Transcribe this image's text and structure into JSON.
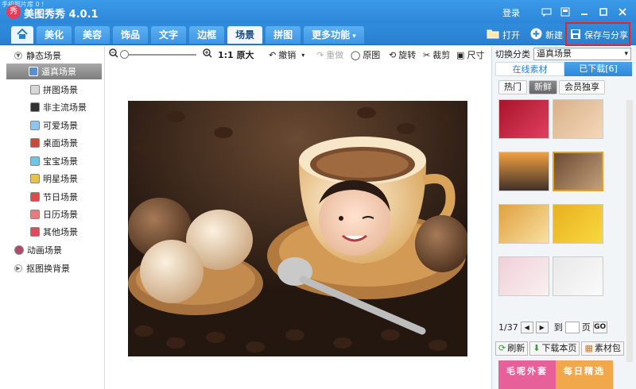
{
  "titlebar": {
    "tiny_text": "手机照片库 0 !",
    "app_title": "美图秀秀 4.0.1",
    "login": "登录",
    "window_icons": [
      "feedback-icon",
      "skin-icon",
      "minimize-icon",
      "maximize-icon",
      "close-icon"
    ]
  },
  "nav": {
    "home_icon": "home-icon",
    "tabs": [
      {
        "label": "美化"
      },
      {
        "label": "美容"
      },
      {
        "label": "饰品"
      },
      {
        "label": "文字"
      },
      {
        "label": "边框"
      },
      {
        "label": "场景",
        "active": true
      },
      {
        "label": "拼图"
      },
      {
        "label": "更多功能"
      }
    ],
    "open_label": "打开",
    "new_label": "新建",
    "save_share_label": "保存与分享"
  },
  "left_panel": {
    "static_header": "静态场景",
    "items": [
      "逼真场景",
      "拼图场景",
      "非主流场景",
      "可爱场景",
      "桌面场景",
      "宝宝场景",
      "明星场景",
      "节日场景",
      "日历场景",
      "其他场景"
    ],
    "selected_index": 0,
    "animated": "动画场景",
    "cutout": "抠图换背景"
  },
  "edit_toolbar": {
    "zoom_level": 0.0,
    "original_size": "1:1 原大",
    "undo": "撤销",
    "redo": "重做",
    "original": "原图",
    "rotate": "旋转",
    "crop": "裁剪",
    "resize": "尺寸"
  },
  "right_panel": {
    "switch_label": "切换分类",
    "category_value": "逼真场景",
    "tab_online": "在线素材",
    "tab_downloaded": "已下载[6]",
    "subtabs": [
      "热门",
      "新鲜",
      "会员独享"
    ],
    "active_subtab": 1,
    "page_current": "1/37",
    "to_label": "到",
    "page_label": "页",
    "go_label": "GO",
    "refresh": "刷新",
    "download_page": "下载本页",
    "materials": "素材包",
    "banner_left": "毛呢外套",
    "banner_right": "每日精选"
  },
  "colors": {
    "title_blue": "#2d86d8",
    "highlight_red": "#e02626",
    "selected_gold": "#e3a41a"
  }
}
